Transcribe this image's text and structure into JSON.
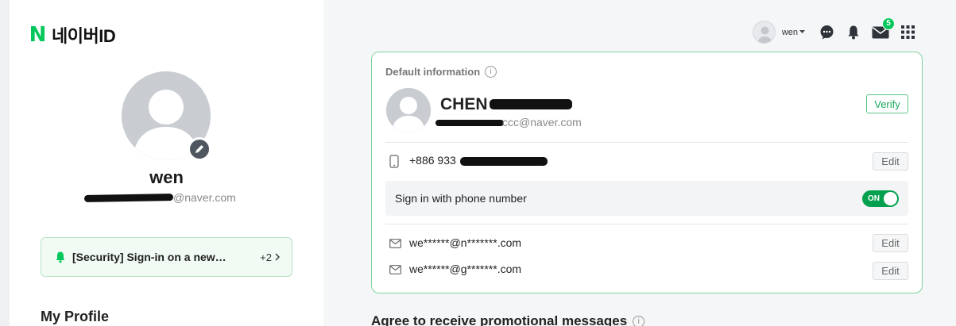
{
  "logo": {
    "mark": "N",
    "text": "네이버ID"
  },
  "profile": {
    "name": "wen",
    "email_domain": "@naver.com"
  },
  "alert": {
    "text": "[Security] Sign-in on a new…",
    "count": "+2"
  },
  "sidebar": {
    "section_title": "My Profile"
  },
  "topbar": {
    "username": "wen",
    "mail_count": "5",
    "icons": [
      "user-avatar-icon",
      "chat-icon",
      "bell-icon",
      "mail-icon",
      "apps-grid-icon"
    ]
  },
  "card": {
    "title": "Default information",
    "name_visible": "CHEN",
    "email_tail": "ccc@naver.com",
    "verify_label": "Verify",
    "phone_prefix": "+886 933",
    "phone_edit": "Edit",
    "signin_label": "Sign in with phone number",
    "toggle_label": "ON",
    "emails": [
      {
        "value": "we******@n*******.com",
        "edit": "Edit"
      },
      {
        "value": "we******@g*******.com",
        "edit": "Edit"
      }
    ]
  },
  "promo": {
    "title": "Agree to receive promotional messages"
  },
  "colors": {
    "brand_green": "#03c75a",
    "card_border": "#7fd3a1",
    "toggle_on": "#03a14f"
  }
}
